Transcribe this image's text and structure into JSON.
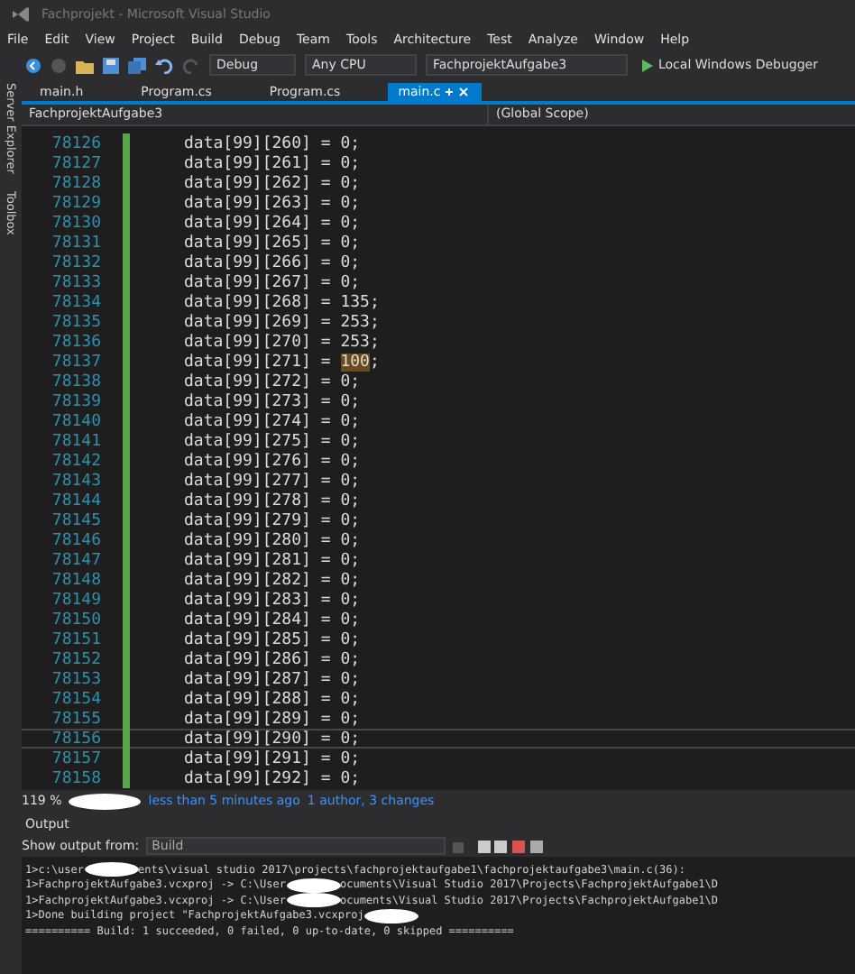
{
  "window": {
    "title": "Fachprojekt - Microsoft Visual Studio"
  },
  "menu": [
    "File",
    "Edit",
    "View",
    "Project",
    "Build",
    "Debug",
    "Team",
    "Tools",
    "Architecture",
    "Test",
    "Analyze",
    "Window",
    "Help"
  ],
  "toolbar": {
    "configuration": "Debug",
    "platform": "Any CPU",
    "startup_project": "FachprojektAufgabe3",
    "run_label": "Local Windows Debugger"
  },
  "side_tabs": [
    "Server Explorer",
    "Toolbox"
  ],
  "tabs": [
    {
      "label": "main.h",
      "selected": false
    },
    {
      "label": "Program.cs",
      "selected": false
    },
    {
      "label": "Program.cs",
      "selected": false
    },
    {
      "label": "main.c",
      "selected": true
    }
  ],
  "nav_bar": {
    "project": "FachprojektAufgabe3",
    "scope": "(Global Scope)"
  },
  "code_lines": [
    {
      "number": "78126",
      "code": "data[99][260] = 0;",
      "current": false
    },
    {
      "number": "78127",
      "code": "data[99][261] = 0;",
      "current": false
    },
    {
      "number": "78128",
      "code": "data[99][262] = 0;",
      "current": false
    },
    {
      "number": "78129",
      "code": "data[99][263] = 0;",
      "current": false
    },
    {
      "number": "78130",
      "code": "data[99][264] = 0;",
      "current": false
    },
    {
      "number": "78131",
      "code": "data[99][265] = 0;",
      "current": false
    },
    {
      "number": "78132",
      "code": "data[99][266] = 0;",
      "current": false
    },
    {
      "number": "78133",
      "code": "data[99][267] = 0;",
      "current": false
    },
    {
      "number": "78134",
      "code": "data[99][268] = 135;",
      "current": false
    },
    {
      "number": "78135",
      "code": "data[99][269] = 253;",
      "current": false
    },
    {
      "number": "78136",
      "code": "data[99][270] = 253;",
      "current": false
    },
    {
      "number": "78137",
      "code": "data[99][271] = ",
      "highlight": "100",
      "code_after": ";",
      "current": false
    },
    {
      "number": "78138",
      "code": "data[99][272] = 0;",
      "current": false
    },
    {
      "number": "78139",
      "code": "data[99][273] = 0;",
      "current": false
    },
    {
      "number": "78140",
      "code": "data[99][274] = 0;",
      "current": false
    },
    {
      "number": "78141",
      "code": "data[99][275] = 0;",
      "current": false
    },
    {
      "number": "78142",
      "code": "data[99][276] = 0;",
      "current": false
    },
    {
      "number": "78143",
      "code": "data[99][277] = 0;",
      "current": false
    },
    {
      "number": "78144",
      "code": "data[99][278] = 0;",
      "current": false
    },
    {
      "number": "78145",
      "code": "data[99][279] = 0;",
      "current": false
    },
    {
      "number": "78146",
      "code": "data[99][280] = 0;",
      "current": false
    },
    {
      "number": "78147",
      "code": "data[99][281] = 0;",
      "current": false
    },
    {
      "number": "78148",
      "code": "data[99][282] = 0;",
      "current": false
    },
    {
      "number": "78149",
      "code": "data[99][283] = 0;",
      "current": false
    },
    {
      "number": "78150",
      "code": "data[99][284] = 0;",
      "current": false
    },
    {
      "number": "78151",
      "code": "data[99][285] = 0;",
      "current": false
    },
    {
      "number": "78152",
      "code": "data[99][286] = 0;",
      "current": false
    },
    {
      "number": "78153",
      "code": "data[99][287] = 0;",
      "current": false
    },
    {
      "number": "78154",
      "code": "data[99][288] = 0;",
      "current": false
    },
    {
      "number": "78155",
      "code": "data[99][289] = 0;",
      "current": false
    },
    {
      "number": "78156",
      "code": "data[99][290] = 0;",
      "current": true
    },
    {
      "number": "78157",
      "code": "data[99][291] = 0;",
      "current": false
    },
    {
      "number": "78158",
      "code": "data[99][292] = 0;",
      "current": false
    }
  ],
  "status_bar": {
    "zoom": "119 %",
    "history": "less than 5 minutes ago",
    "authors": "1 author, 3 changes"
  },
  "output": {
    "title": "Output",
    "source_label": "Show output from:",
    "source": "Build",
    "lines": [
      [
        "1>c:\\user",
        "ents\\visual studio 2017\\projects\\fachprojektaufgabe1\\fachprojektaufgabe3\\main.c(36):"
      ],
      [
        "1>FachprojektAufgabe3.vcxproj -> C:\\User",
        "ocuments\\Visual Studio 2017\\Projects\\FachprojektAufgabe1\\D"
      ],
      [
        "1>FachprojektAufgabe3.vcxproj -> C:\\User",
        "ocuments\\Visual Studio 2017\\Projects\\FachprojektAufgabe1\\D"
      ],
      [
        "1>Done building project \"FachprojektAufgabe3.vcxproj"
      ],
      [
        "========== Build: 1 succeeded, 0 failed, 0 up-to-date, 0 skipped =========="
      ]
    ]
  }
}
